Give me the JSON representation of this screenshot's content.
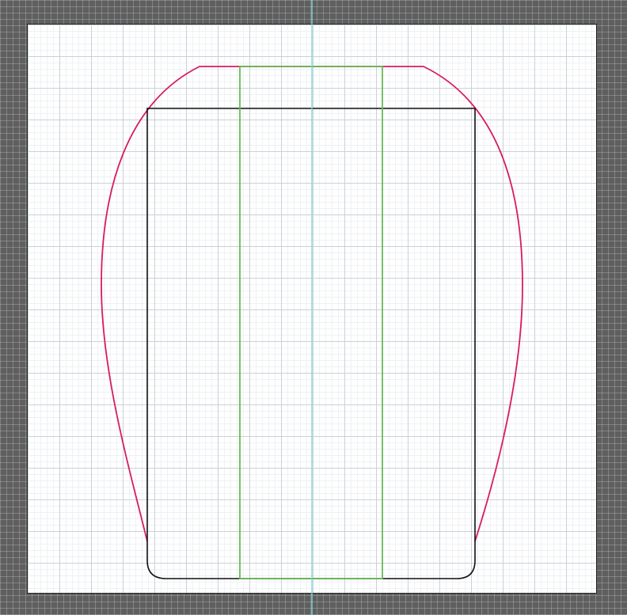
{
  "canvas": {
    "workspace_bg": "#5f5f5f",
    "artboard_bg": "#ffffff",
    "grid_minor": "#eef1f3",
    "grid_major": "#c9d2d8"
  },
  "shapes": {
    "outer_curve_color": "#d81b60",
    "inner_box_color": "#111111",
    "center_strip_color": "#66bb55",
    "center_guide_color": "#7fd6dc"
  }
}
